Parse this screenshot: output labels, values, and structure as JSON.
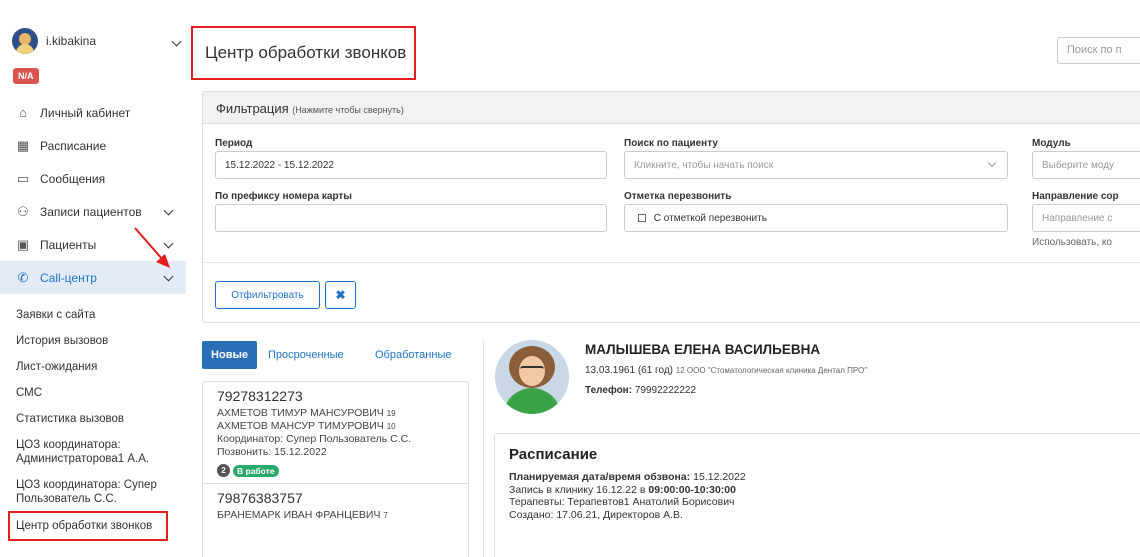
{
  "user": {
    "name": "i.kibakina",
    "badge": "N/A"
  },
  "nav": [
    {
      "label": "Личный кабинет",
      "icon": "home-icon",
      "glyph": "⌂"
    },
    {
      "label": "Расписание",
      "icon": "calendar-icon",
      "glyph": "▦"
    },
    {
      "label": "Сообщения",
      "icon": "message-icon",
      "glyph": "▭"
    },
    {
      "label": "Записи пациентов",
      "icon": "people-icon",
      "glyph": "⚇"
    },
    {
      "label": "Пациенты",
      "icon": "patient-card-icon",
      "glyph": "▣"
    },
    {
      "label": "Call-центр",
      "icon": "phone-icon",
      "glyph": "✆"
    }
  ],
  "callcenter_submenu": [
    "Заявки с сайта",
    "История вызовов",
    "Лист-ожидания",
    "СМС",
    "Статистика вызовов",
    "ЦОЗ координатора: Администраторова1 А.А.",
    "ЦОЗ координатора: Супер Пользователь С.С.",
    "Центр обработки звонков"
  ],
  "page": {
    "title": "Центр обработки звонков",
    "search_placeholder": "Поиск по п"
  },
  "filter": {
    "title": "Фильтрация",
    "hint": "(Нажмите чтобы свернуть)",
    "period_label": "Период",
    "period_value": "15.12.2022 - 15.12.2022",
    "patient_search_label": "Поиск по пациенту",
    "patient_search_placeholder": "Кликните, чтобы начать поиск",
    "module_label": "Модуль",
    "module_placeholder": "Выберите моду",
    "card_prefix_label": "По префиксу номера карты",
    "callback_label": "Отметка перезвонить",
    "callback_option": "С отметкой перезвонить",
    "direction_label": "Направление сор",
    "direction_placeholder": "Направление с",
    "direction_hint": "Использовать, ко",
    "apply_button": "Отфильтровать",
    "clear_button": "✖"
  },
  "tabs": {
    "new": "Новые",
    "overdue": "Просроченные",
    "processed": "Обработанные"
  },
  "calls": [
    {
      "phone": "79278312273",
      "people": [
        {
          "name": "АХМЕТОВ ТИМУР МАНСУРОВИЧ",
          "age": "19"
        },
        {
          "name": "АХМЕТОВ МАНСУР ТИМУРОВИЧ",
          "age": "10"
        }
      ],
      "coordinator": "Координатор: Супер Пользователь С.С.",
      "call_date": "Позвонить: 15.12.2022",
      "count": "2",
      "status": "В работе"
    },
    {
      "phone": "79876383757",
      "people": [
        {
          "name": "БРАНЕМАРК ИВАН ФРАНЦЕВИЧ",
          "age": "7"
        }
      ]
    }
  ],
  "patient": {
    "name": "МАЛЫШЕВА ЕЛЕНА ВАСИЛЬЕВНА",
    "birth": "13.03.1961 (61 год)",
    "clinic": "12 ООО \"Стоматологическая клиника Дентал ПРО\"",
    "phone_label": "Телефон:",
    "phone": "79992222222"
  },
  "schedule": {
    "title": "Расписание",
    "planned_label": "Планируемая дата/время обзвона:",
    "planned_value": "15.12.2022",
    "visit_prefix": "Запись в клинику 16.12.22 в",
    "visit_time": "09:00:00-10:30:00",
    "therapists": "Терапевты: Терапевтов1 Анатолий Борисович",
    "created": "Создано: 17.06.21, Директоров А.В."
  },
  "colors": {
    "accent": "#1e73c8",
    "highlight_border": "#e41d1d",
    "active_nav_bg": "#e3ebf7",
    "status_green": "#29a96a",
    "badge_red": "#d9534f"
  }
}
